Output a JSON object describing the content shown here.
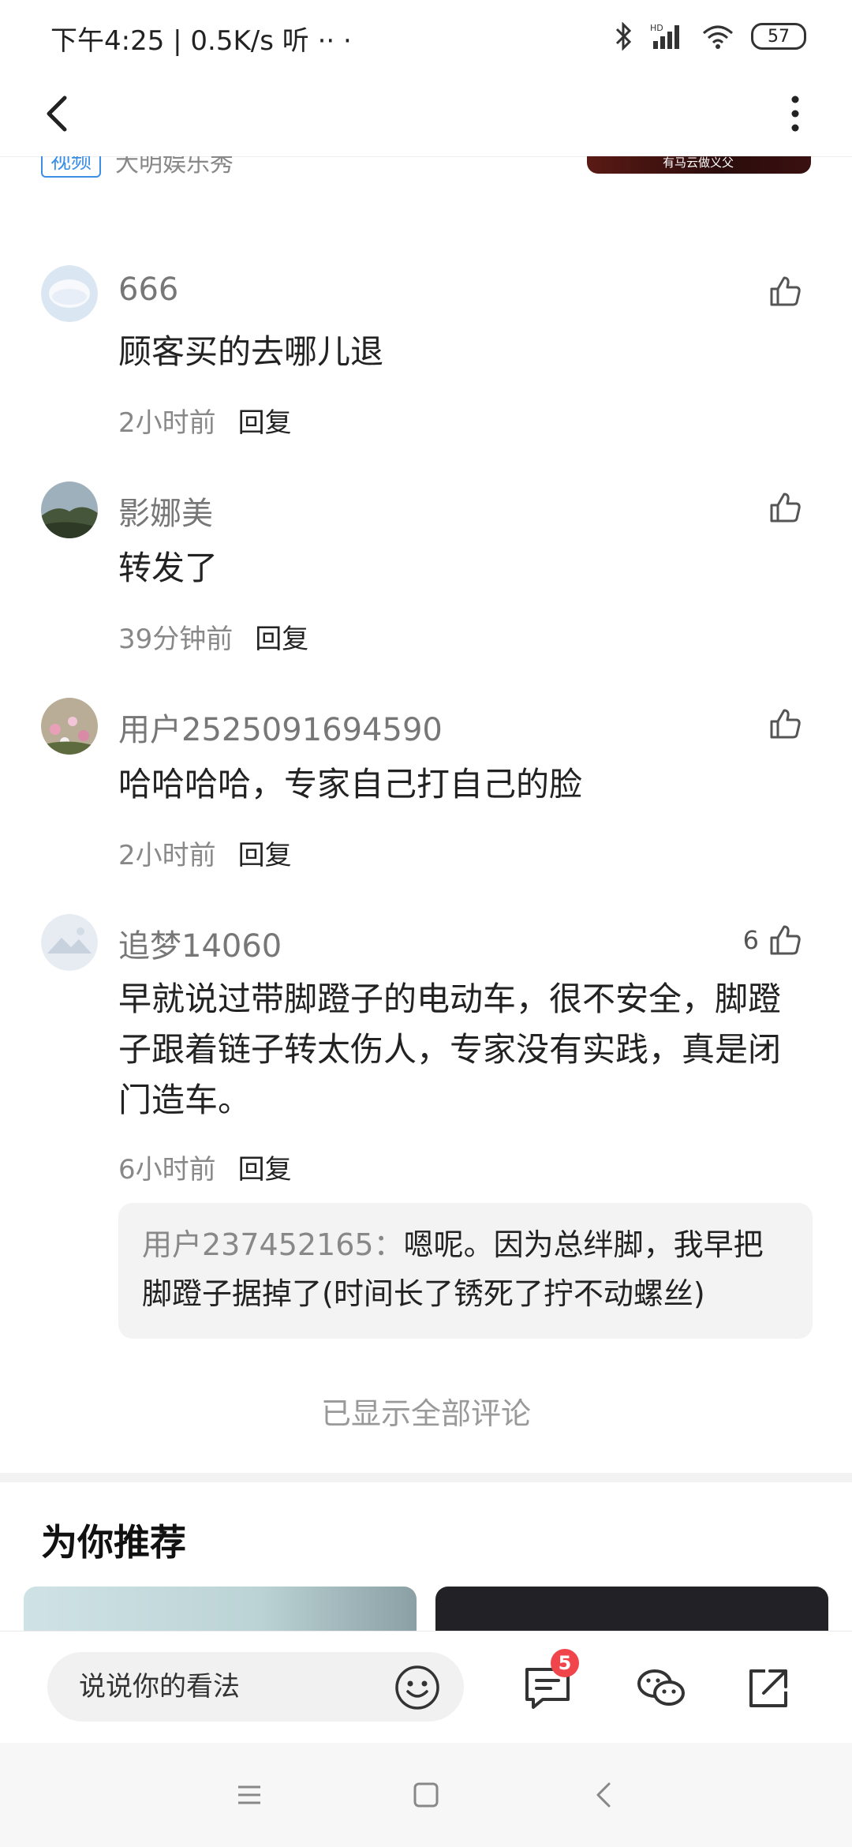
{
  "status_bar": {
    "left_text": "下午4:25 | 0.5K/s 听  ··  ·",
    "battery": "57"
  },
  "header_fragment": {
    "tag": "视频",
    "source": "大明娱乐秀",
    "thumb_caption": "有马云做义父"
  },
  "comments": [
    {
      "user": "666",
      "text": "顾客买的去哪儿退",
      "time": "2小时前",
      "reply_label": "回复",
      "likes": ""
    },
    {
      "user": "影娜美",
      "text": "转发了",
      "time": "39分钟前",
      "reply_label": "回复",
      "likes": ""
    },
    {
      "user": "用户2525091694590",
      "text": "哈哈哈哈，专家自己打自己的脸",
      "time": "2小时前",
      "reply_label": "回复",
      "likes": ""
    },
    {
      "user": "追梦14060",
      "text": "早就说过带脚蹬子的电动车，很不安全，脚蹬子跟着链子转太伤人，专家没有实践，真是闭门造车。",
      "time": "6小时前",
      "reply_label": "回复",
      "likes": "6"
    }
  ],
  "nested_reply": {
    "user": "用户237452165：",
    "text": "嗯呢。因为总绊脚，我早把脚蹬子据掉了(时间长了锈死了拧不动螺丝)"
  },
  "all_shown_text": "已显示全部评论",
  "recommend_title": "为你推荐",
  "bottom_bar": {
    "input_placeholder": "说说你的看法",
    "comment_badge": "5"
  },
  "colors": {
    "accent_blue": "#3a8ee6",
    "badge_red": "#f0454a",
    "muted_text": "#888888"
  }
}
